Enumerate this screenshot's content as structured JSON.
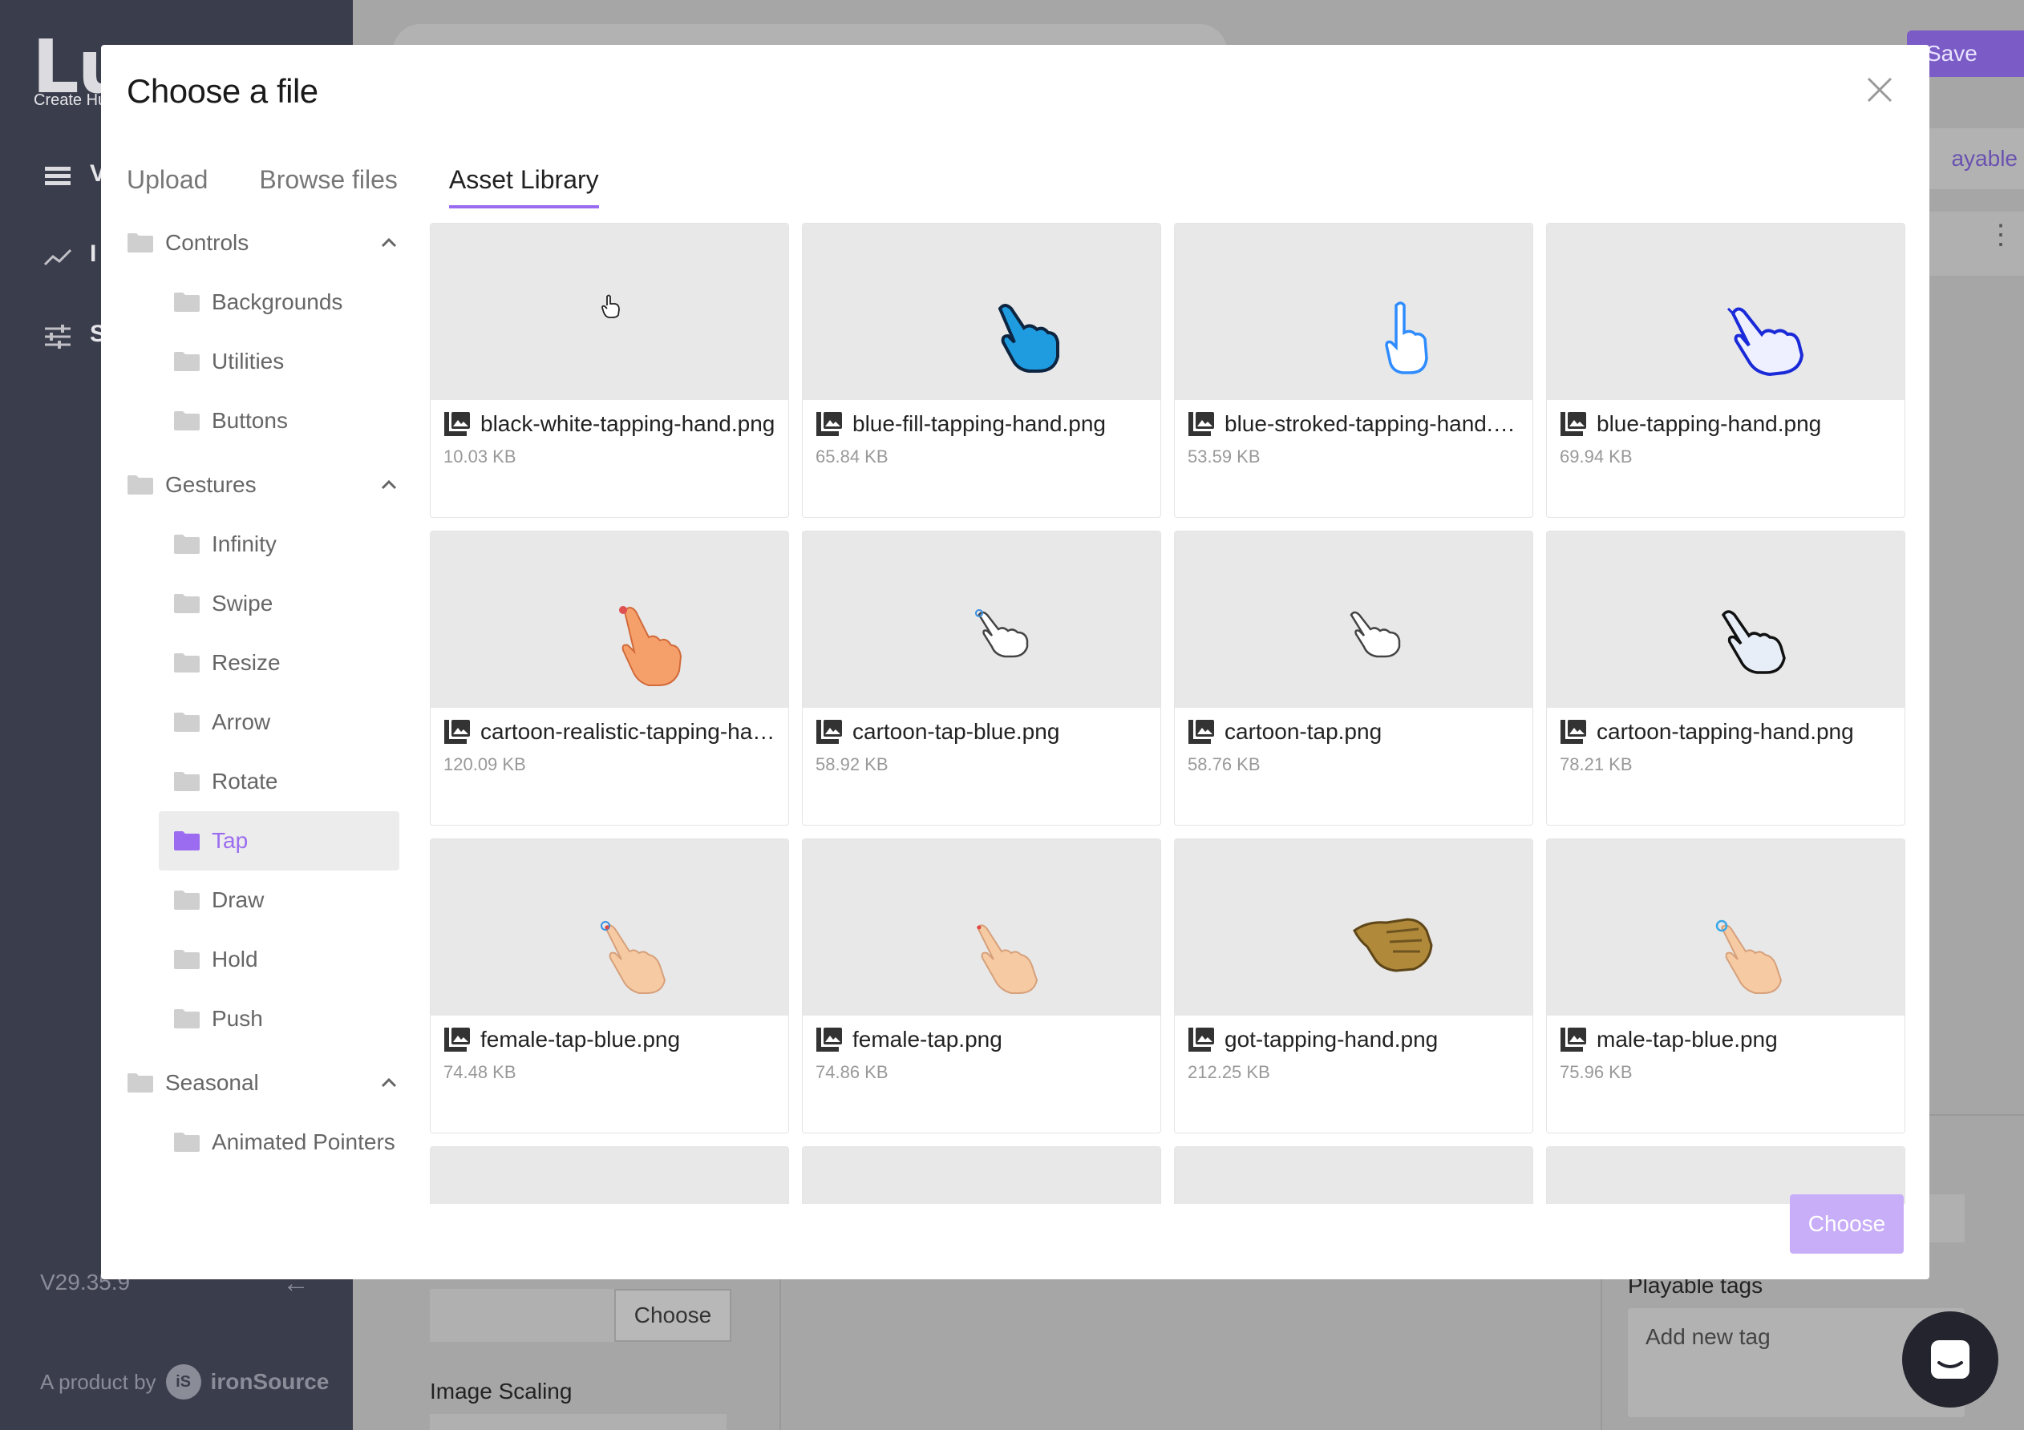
{
  "app": {
    "brand": "Luna",
    "tagline": "Create Hu",
    "nav_letters": [
      "V",
      "I",
      "S"
    ],
    "version": "V29.35.9",
    "product_by": "A product by",
    "company_badge": "iS",
    "company": "ironSource",
    "save_label": "Save",
    "playable_tab_label": "ayable",
    "bg_choose_label": "Choose",
    "image_scaling_label": "Image Scaling",
    "playable_tags_label": "Playable tags",
    "add_tag_placeholder": "Add new tag",
    "accent_color": "#9b6cf0"
  },
  "modal": {
    "title": "Choose a file",
    "tabs": [
      {
        "label": "Upload",
        "active": false
      },
      {
        "label": "Browse files",
        "active": false
      },
      {
        "label": "Asset Library",
        "active": true
      }
    ],
    "tree": [
      {
        "type": "group",
        "label": "Controls",
        "expanded": true
      },
      {
        "type": "item",
        "label": "Backgrounds"
      },
      {
        "type": "item",
        "label": "Utilities"
      },
      {
        "type": "item",
        "label": "Buttons"
      },
      {
        "type": "group",
        "label": "Gestures",
        "expanded": true
      },
      {
        "type": "item",
        "label": "Infinity"
      },
      {
        "type": "item",
        "label": "Swipe"
      },
      {
        "type": "item",
        "label": "Resize"
      },
      {
        "type": "item",
        "label": "Arrow"
      },
      {
        "type": "item",
        "label": "Rotate"
      },
      {
        "type": "item",
        "label": "Tap",
        "selected": true
      },
      {
        "type": "item",
        "label": "Draw"
      },
      {
        "type": "item",
        "label": "Hold"
      },
      {
        "type": "item",
        "label": "Push"
      },
      {
        "type": "group",
        "label": "Seasonal",
        "expanded": true
      },
      {
        "type": "item",
        "label": "Animated Pointers"
      }
    ],
    "files": [
      {
        "name": "black-white-tapping-hand.png",
        "size": "10.03 KB",
        "icon": "small-outline-hand-icon"
      },
      {
        "name": "blue-fill-tapping-hand.png",
        "size": "65.84 KB",
        "icon": "blue-fill-hand-icon"
      },
      {
        "name": "blue-stroked-tapping-hand.png",
        "size": "53.59 KB",
        "icon": "blue-stroked-hand-icon"
      },
      {
        "name": "blue-tapping-hand.png",
        "size": "69.94 KB",
        "icon": "blue-tapping-hand-icon"
      },
      {
        "name": "cartoon-realistic-tapping-han...",
        "size": "120.09 KB",
        "icon": "cartoon-realistic-hand-icon"
      },
      {
        "name": "cartoon-tap-blue.png",
        "size": "58.92 KB",
        "icon": "cartoon-tap-blue-icon"
      },
      {
        "name": "cartoon-tap.png",
        "size": "58.76 KB",
        "icon": "cartoon-tap-icon"
      },
      {
        "name": "cartoon-tapping-hand.png",
        "size": "78.21 KB",
        "icon": "cartoon-tapping-hand-icon"
      },
      {
        "name": "female-tap-blue.png",
        "size": "74.48 KB",
        "icon": "female-tap-blue-icon"
      },
      {
        "name": "female-tap.png",
        "size": "74.86 KB",
        "icon": "female-tap-icon"
      },
      {
        "name": "got-tapping-hand.png",
        "size": "212.25 KB",
        "icon": "gold-hand-icon"
      },
      {
        "name": "male-tap-blue.png",
        "size": "75.96 KB",
        "icon": "male-tap-blue-icon"
      }
    ],
    "choose_label": "Choose"
  }
}
